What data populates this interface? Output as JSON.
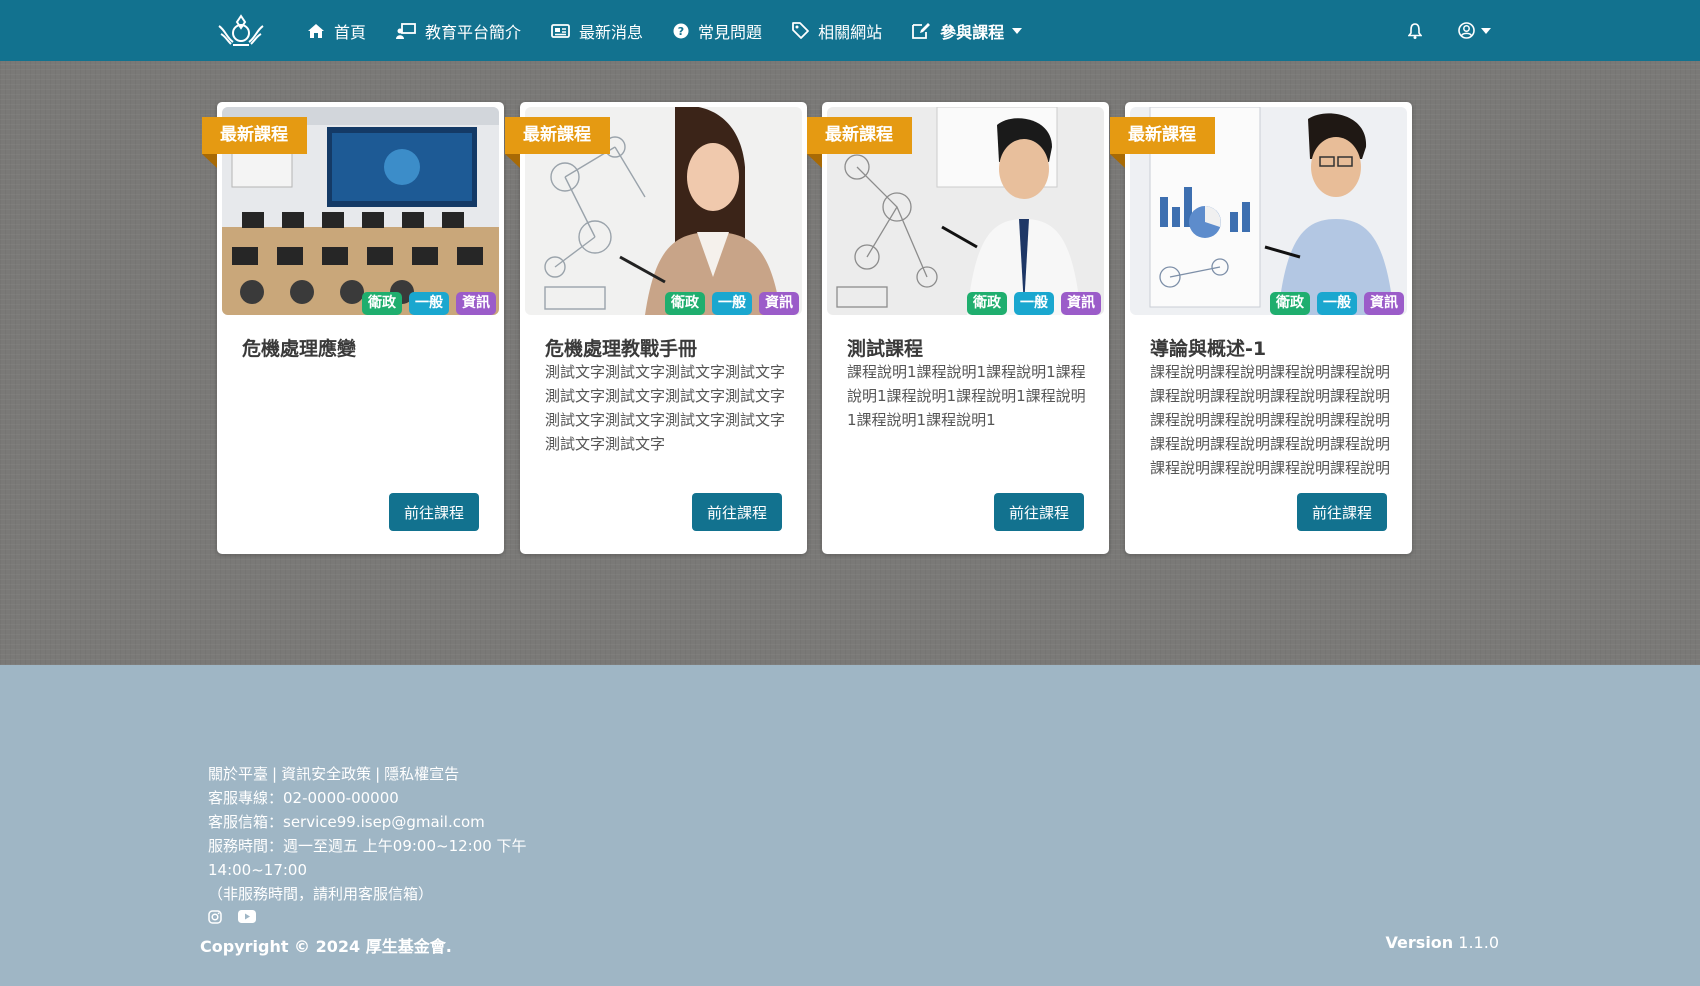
{
  "nav": {
    "items": [
      {
        "label": "首頁",
        "icon": "home-icon"
      },
      {
        "label": "教育平台簡介",
        "icon": "chalkboard-teacher-icon"
      },
      {
        "label": "最新消息",
        "icon": "newspaper-icon"
      },
      {
        "label": "常見問題",
        "icon": "question-circle-icon"
      },
      {
        "label": "相關網站",
        "icon": "tag-icon"
      },
      {
        "label": "參與課程",
        "icon": "edit-icon"
      }
    ],
    "bell_icon": "bell-icon",
    "user_icon": "user-circle-icon"
  },
  "courses": [
    {
      "ribbon": "最新課程",
      "tags": [
        "衛政",
        "一般",
        "資訊"
      ],
      "title": "危機處理應變",
      "description": "",
      "button": "前往課程"
    },
    {
      "ribbon": "最新課程",
      "tags": [
        "衛政",
        "一般",
        "資訊"
      ],
      "title": "危機處理教戰手冊",
      "description": "測試文字測試文字測試文字測試文字測試文字測試文字測試文字測試文字測試文字測試文字測試文字測試文字測試文字測試文字",
      "button": "前往課程"
    },
    {
      "ribbon": "最新課程",
      "tags": [
        "衛政",
        "一般",
        "資訊"
      ],
      "title": "測試課程",
      "description": "課程說明1課程說明1課程說明1課程說明1課程說明1課程說明1課程說明1課程說明1課程說明1",
      "button": "前往課程"
    },
    {
      "ribbon": "最新課程",
      "tags": [
        "衛政",
        "一般",
        "資訊"
      ],
      "title": "導論與概述-1",
      "description": "課程說明課程說明課程說明課程說明課程說明課程說明課程說明課程說明課程說明課程說明課程說明課程說明課程說明課程說明課程說明課程說明課程說明課程說明課程說明課程說明",
      "button": "前往課程"
    }
  ],
  "footer": {
    "links": [
      "關於平臺",
      "資訊安全政策",
      "隱私權宣告"
    ],
    "separator": "|",
    "phone": "客服專線：02-0000-00000",
    "email": "客服信箱：service99.isep@gmail.com",
    "hours": "服務時間：週一至週五 上午09:00~12:00 下午14:00~17:00",
    "note": "（非服務時間，請利用客服信箱）",
    "social_icons": [
      "instagram-icon",
      "youtube-icon"
    ],
    "copyright": "Copyright © 2024 厚生基金會.",
    "version_label": "Version",
    "version_number": "1.1.0"
  },
  "colors": {
    "navbar": "#12728f",
    "ribbon": "#e59a12",
    "tag_green": "#1fae6e",
    "tag_blue": "#1aa7cf",
    "tag_purple": "#9b5cc9",
    "footer": "#9fb6c5"
  }
}
